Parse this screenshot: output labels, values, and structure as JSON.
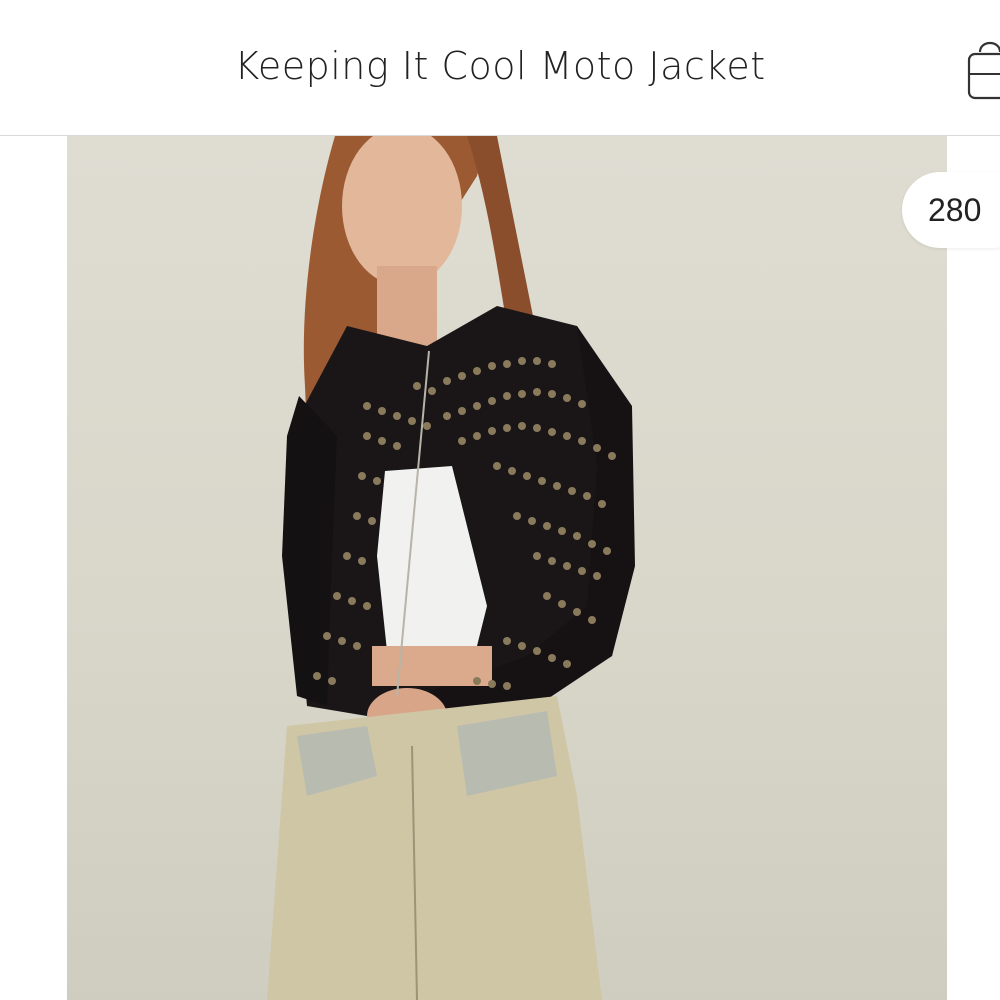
{
  "header": {
    "title": "Keeping It Cool Moto Jacket",
    "bag_icon": "shopping-bag-icon"
  },
  "gallery": {
    "image_subject": "product-photo",
    "count_badge": "280"
  },
  "colors": {
    "background": "#ffffff",
    "photo_background": "#dcdacf",
    "text": "#222222",
    "jacket": "#1a1618",
    "studs": "#8a7a5c",
    "jeans": "#cfc6a6"
  }
}
